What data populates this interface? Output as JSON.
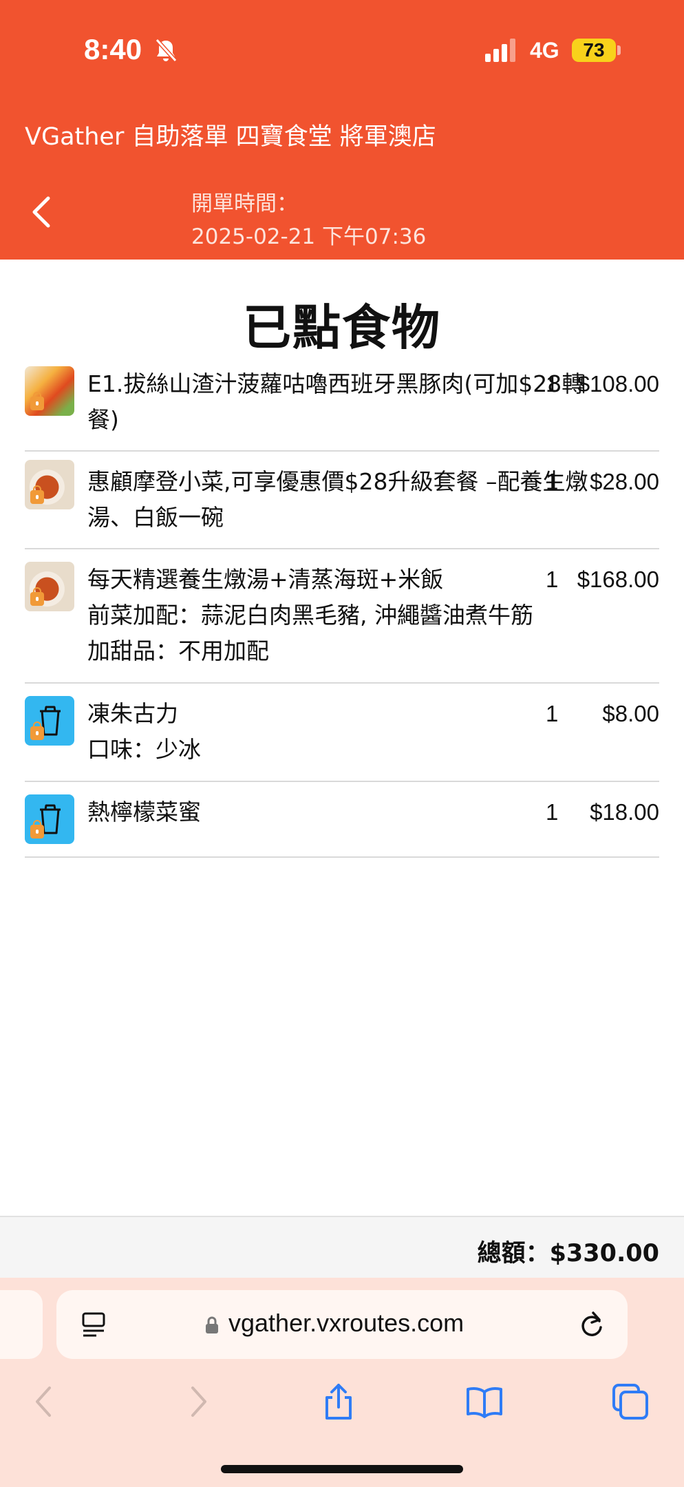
{
  "status_bar": {
    "time": "8:40",
    "network": "4G",
    "battery": "73"
  },
  "header": {
    "title": "VGather 自助落單 四寶食堂 將軍澳店",
    "open_label": "開單時間：",
    "open_time": "2025-02-21 下午07:36"
  },
  "page_title": "已點食物",
  "orders": [
    {
      "name": "E1.拔絲山渣汁菠蘿咕嚕西班牙黑豚肉(可加$28轉餐)",
      "qty": "1",
      "price": "$108.00",
      "thumb": "food-photo",
      "details": []
    },
    {
      "name": "惠顧摩登小菜,可享優惠價$28升級套餐 –配養生燉湯、白飯一碗",
      "qty": "1",
      "price": "$28.00",
      "thumb": "soup-photo",
      "details": []
    },
    {
      "name": "每天精選養生燉湯+清蒸海斑+米飯",
      "qty": "1",
      "price": "$168.00",
      "thumb": "soup-photo",
      "details": [
        "前菜加配：蒜泥白肉黑毛豬, 沖繩醬油煮牛筋",
        "加甜品：不用加配"
      ]
    },
    {
      "name": "凍朱古力",
      "qty": "1",
      "price": "$8.00",
      "thumb": "drink-cup-icon",
      "details": [
        "口味：少冰"
      ]
    },
    {
      "name": "熱檸檬菜蜜",
      "qty": "1",
      "price": "$18.00",
      "thumb": "drink-cup-icon",
      "details": []
    }
  ],
  "total": "總額：$330.00",
  "browser": {
    "url": "vgather.vxroutes.com"
  },
  "colors": {
    "brand": "#f1532f",
    "browser_bg": "#fde1d8",
    "ios_blue": "#2f7cf6",
    "drink_tile": "#33b7f0"
  }
}
